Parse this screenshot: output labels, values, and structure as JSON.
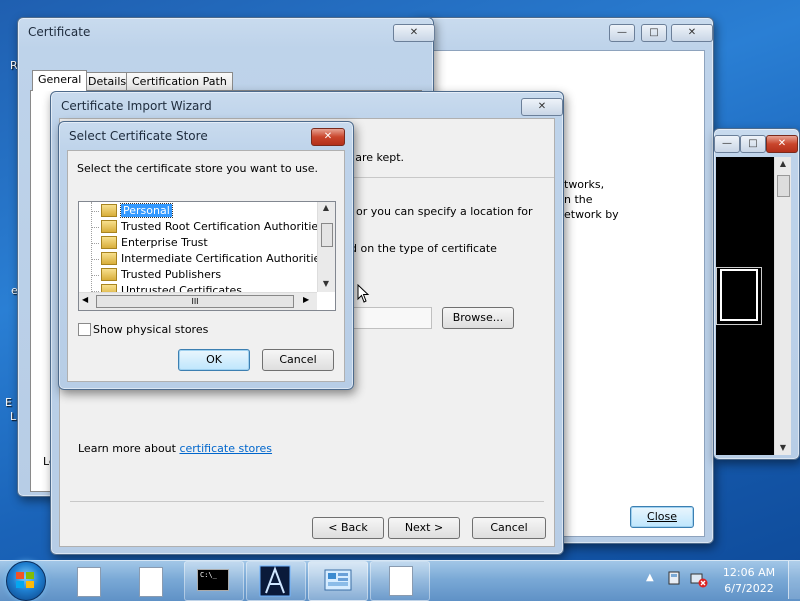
{
  "desktop": {
    "left_letters": [
      "R",
      "e",
      "E",
      "L"
    ]
  },
  "back_window": {
    "caption": {
      "minimize": "—",
      "maximize": "□",
      "close": "✕"
    },
    "text_lines": [
      "tworks,",
      "n the",
      "etwork by"
    ],
    "close_button": "Close"
  },
  "console_window": {
    "caption": {
      "minimize": "—",
      "maximize": "□",
      "close": "✕"
    }
  },
  "certificate": {
    "title": "Certificate",
    "close": "✕",
    "tabs": [
      "General",
      "Details",
      "Certification Path"
    ],
    "bottom_fragment": "Le"
  },
  "wizard": {
    "title": "Certificate Import Wizard",
    "close": "✕",
    "text_lines": [
      "s are kept.",
      "or you can specify a location for",
      "d on the type of certificate"
    ],
    "browse_button": "Browse...",
    "learn_more_prefix": "Learn more about ",
    "learn_more_link": "certificate stores",
    "back_button": "< Back",
    "next_button": "Next >",
    "cancel_button": "Cancel"
  },
  "store_dialog": {
    "title": "Select Certificate Store",
    "close": "✕",
    "prompt": "Select the certificate store you want to use.",
    "stores": [
      "Personal",
      "Trusted Root Certification Authorities",
      "Enterprise Trust",
      "Intermediate Certification Authorities",
      "Trusted Publishers",
      "Untrusted Certificates"
    ],
    "selected_index": 0,
    "show_physical_label": "Show physical stores",
    "show_physical_checked": false,
    "ok_button": "OK",
    "cancel_button": "Cancel",
    "hscroll_grip": "III"
  },
  "taskbar": {
    "cmd_label": "C:\\_",
    "clock_time": "12:06 AM",
    "clock_date": "6/7/2022",
    "tray_arrow": "▲"
  }
}
